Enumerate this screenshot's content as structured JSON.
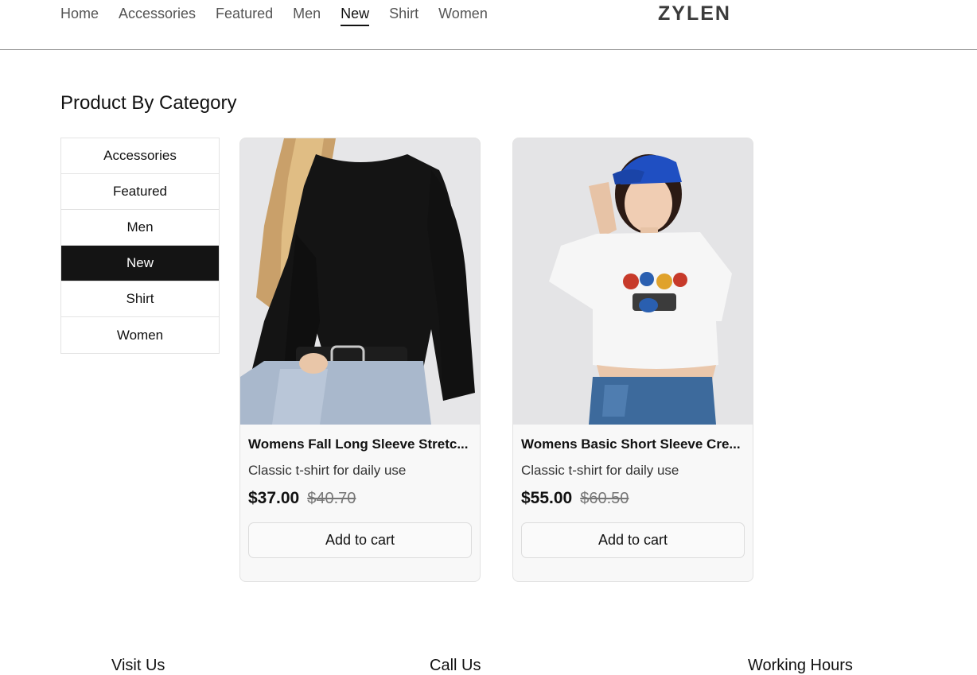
{
  "nav": {
    "items": [
      {
        "label": "Home"
      },
      {
        "label": "Accessories"
      },
      {
        "label": "Featured"
      },
      {
        "label": "Men"
      },
      {
        "label": "New"
      },
      {
        "label": "Shirt"
      },
      {
        "label": "Women"
      }
    ],
    "active_index": 4,
    "logo": "ZYLEN"
  },
  "section": {
    "title": "Product By Category"
  },
  "categories": {
    "items": [
      {
        "label": "Accessories"
      },
      {
        "label": "Featured"
      },
      {
        "label": "Men"
      },
      {
        "label": "New"
      },
      {
        "label": "Shirt"
      },
      {
        "label": "Women"
      }
    ],
    "active_index": 3
  },
  "products": [
    {
      "title": "Womens Fall Long Sleeve Stretc...",
      "description": "Classic t-shirt for daily use",
      "price": "$37.00",
      "old_price": "$40.70",
      "cart_label": "Add to cart",
      "image": "woman-black-long-sleeve-top"
    },
    {
      "title": "Womens Basic Short Sleeve Cre...",
      "description": "Classic t-shirt for daily use",
      "price": "$55.00",
      "old_price": "$60.50",
      "cart_label": "Add to cart",
      "image": "woman-white-crop-tee-blue-cap"
    }
  ],
  "footer": {
    "headings": [
      "Visit Us",
      "Call Us",
      "Working Hours"
    ]
  }
}
